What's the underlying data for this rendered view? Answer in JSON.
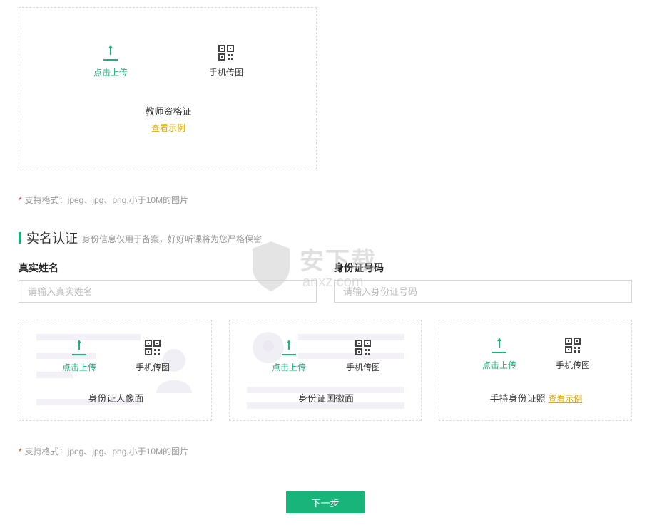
{
  "teacher_cert": {
    "upload_label": "点击上传",
    "phone_label": "手机传图",
    "title": "教师资格证",
    "example_link": "查看示例"
  },
  "format_note_1": "支持格式：jpeg、jpg、png,小于10M的图片",
  "realname": {
    "title": "实名认证",
    "subtitle": "身份信息仅用于备案，好好听课将为您严格保密",
    "name_label": "真实姓名",
    "name_placeholder": "请输入真实姓名",
    "id_label": "身份证号码",
    "id_placeholder": "请输入身份证号码"
  },
  "id_cards": [
    {
      "upload_label": "点击上传",
      "phone_label": "手机传图",
      "title": "身份证人像面"
    },
    {
      "upload_label": "点击上传",
      "phone_label": "手机传图",
      "title": "身份证国徽面"
    },
    {
      "upload_label": "点击上传",
      "phone_label": "手机传图",
      "title": "手持身份证照",
      "example_link": "查看示例"
    }
  ],
  "format_note_2": "支持格式：jpeg、jpg、png,小于10M的图片",
  "next_button": "下一步",
  "watermark": {
    "brand": "安下载",
    "domain": "anxz.com"
  },
  "colors": {
    "accent": "#18b47a",
    "link": "#e0a800",
    "required": "#e0463a"
  }
}
